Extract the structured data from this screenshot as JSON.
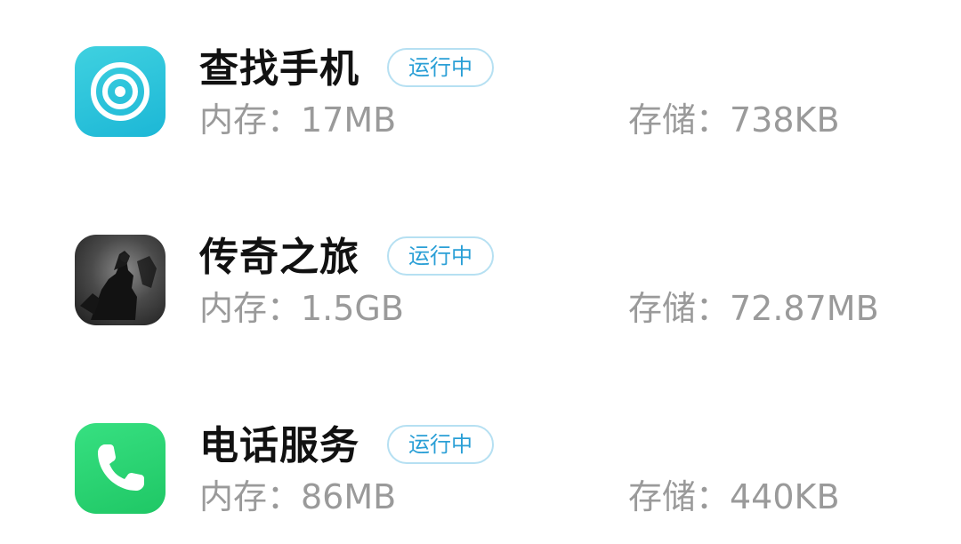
{
  "apps": [
    {
      "name": "查找手机",
      "status": "运行中",
      "memory": "内存：17MB",
      "storage": "存储：738KB",
      "icon": "find-device-icon",
      "icon_color": "#1cb7d6"
    },
    {
      "name": "传奇之旅",
      "status": "运行中",
      "memory": "内存：1.5GB",
      "storage": "存储：72.87MB",
      "icon": "game-art-icon",
      "icon_color": "#2a2a2a"
    },
    {
      "name": "电话服务",
      "status": "运行中",
      "memory": "内存：86MB",
      "storage": "存储：440KB",
      "icon": "phone-icon",
      "icon_color": "#1fc765"
    }
  ],
  "colors": {
    "badge_text": "#2a9fd6",
    "badge_border": "#b6e0f2",
    "secondary_text": "#9a9a9a",
    "title_text": "#111111"
  }
}
